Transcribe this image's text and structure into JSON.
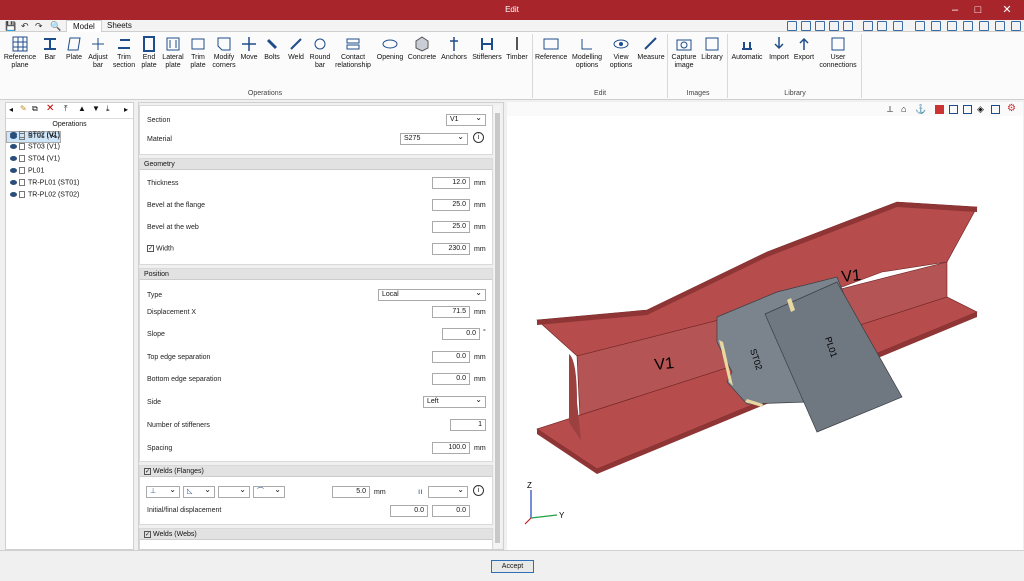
{
  "window": {
    "title": "Edit"
  },
  "tabs": [
    "Model",
    "Sheets"
  ],
  "ribbon": {
    "operations": [
      {
        "label": "Reference\nplane"
      },
      {
        "label": "Bar"
      },
      {
        "label": "Plate"
      },
      {
        "label": "Adjust\nbar"
      },
      {
        "label": "Trim\nsection"
      },
      {
        "label": "End\nplate"
      },
      {
        "label": "Lateral\nplate"
      },
      {
        "label": "Trim\nplate"
      },
      {
        "label": "Modify\ncorners"
      },
      {
        "label": "Move"
      },
      {
        "label": "Bolts"
      },
      {
        "label": "Weld"
      },
      {
        "label": "Round\nbar"
      },
      {
        "label": "Contact\nrelationship"
      },
      {
        "label": "Opening"
      },
      {
        "label": "Concrete"
      },
      {
        "label": "Anchors"
      },
      {
        "label": "Stiffeners"
      },
      {
        "label": "Timber"
      }
    ],
    "edit": [
      {
        "label": "Reference"
      },
      {
        "label": "Modelling\noptions"
      },
      {
        "label": "View\noptions"
      },
      {
        "label": "Measure"
      }
    ],
    "images": [
      {
        "label": "Capture\nimage"
      },
      {
        "label": "Library"
      }
    ],
    "library": [
      {
        "label": "Automatic"
      },
      {
        "label": "Import"
      },
      {
        "label": "Export"
      },
      {
        "label": "User\nconnections"
      }
    ],
    "groups": [
      "Operations",
      "Edit",
      "Images",
      "Library"
    ]
  },
  "left": {
    "header": "Operations",
    "items": [
      "ST01 (V1)",
      "ST02 (V1)",
      "ST03 (V1)",
      "ST04 (V1)",
      "PL01",
      "TR-PL01 (ST01)",
      "TR-PL02 (ST02)"
    ]
  },
  "props": {
    "section_label": "Section",
    "section_value": "V1",
    "material_label": "Material",
    "material_value": "S275",
    "geometry": {
      "header": "Geometry",
      "thickness_label": "Thickness",
      "thickness": "12.0",
      "bevel_flange_label": "Bevel at the flange",
      "bevel_flange": "25.0",
      "bevel_web_label": "Bevel at the web",
      "bevel_web": "25.0",
      "width_label": "Width",
      "width": "230.0",
      "unit": "mm"
    },
    "position": {
      "header": "Position",
      "type_label": "Type",
      "type_value": "Local",
      "dispx_label": "Displacement X",
      "dispx": "71.5",
      "slope_label": "Slope",
      "slope": "0.0",
      "slope_unit": "°",
      "top_label": "Top edge separation",
      "top": "0.0",
      "bottom_label": "Bottom edge separation",
      "bottom": "0.0",
      "side_label": "Side",
      "side_value": "Left",
      "num_label": "Number of stiffeners",
      "num": "1",
      "spacing_label": "Spacing",
      "spacing": "100.0"
    },
    "welds_flanges": {
      "header": "Welds (Flanges)",
      "size": "5.0",
      "initial_label": "Initial/final displacement",
      "initial": "0.0",
      "final": "0.0"
    },
    "welds_webs": {
      "header": "Welds (Webs)"
    }
  },
  "view": {
    "labels": [
      "V1",
      "V1",
      "ST02",
      "PL01"
    ],
    "axes": {
      "z": "Z",
      "y": "Y"
    }
  },
  "buttons": {
    "accept": "Accept"
  },
  "colors": {
    "titlebar": "#a8262b",
    "beam": "#a94a4a",
    "plate": "#6f7780"
  }
}
